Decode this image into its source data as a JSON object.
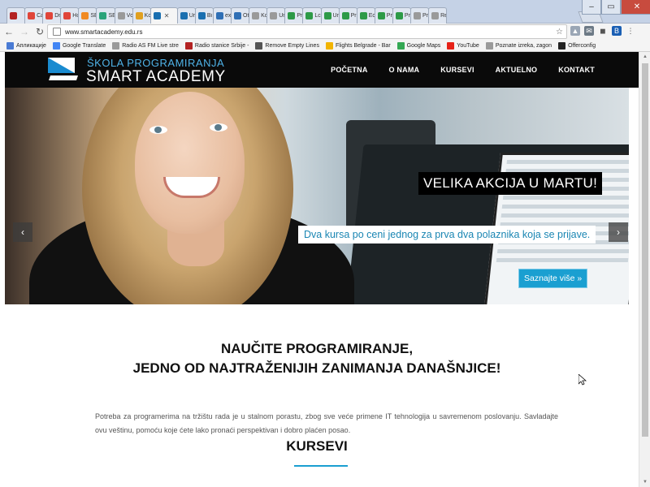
{
  "browser": {
    "tabs": [
      {
        "label": "",
        "icon": "red-tab-icon",
        "color": "#b32222"
      },
      {
        "label": "Ca",
        "icon": "heart-icon",
        "color": "#e0453a"
      },
      {
        "label": "Dr",
        "icon": "heart-icon",
        "color": "#e0453a"
      },
      {
        "label": "Hc",
        "icon": "heart-icon",
        "color": "#e0453a"
      },
      {
        "label": "ŠE",
        "icon": "orange-x-icon",
        "color": "#f08a24"
      },
      {
        "label": "ŠE",
        "icon": "green-a-icon",
        "color": "#2aa37a"
      },
      {
        "label": "Vc",
        "icon": "page-icon",
        "color": "#9a9a9a"
      },
      {
        "label": "Kc",
        "icon": "kodi-icon",
        "color": "#e0a020"
      },
      {
        "label": "",
        "icon": "smart-academy-icon",
        "color": "#1a6fb0",
        "active": true
      },
      {
        "label": "Ur",
        "icon": "smart-academy-icon",
        "color": "#1a6fb0"
      },
      {
        "label": "Bi",
        "icon": "smart-academy-icon",
        "color": "#1a6fb0"
      },
      {
        "label": "ex",
        "icon": "globe-icon",
        "color": "#2f6fb5"
      },
      {
        "label": "Ot",
        "icon": "globe-icon",
        "color": "#2f6fb5"
      },
      {
        "label": "Kc",
        "icon": "page-icon",
        "color": "#9a9a9a"
      },
      {
        "label": "Ur",
        "icon": "page-icon",
        "color": "#9a9a9a"
      },
      {
        "label": "Pr",
        "icon": "check-icon",
        "color": "#2d9a47"
      },
      {
        "label": "Lc",
        "icon": "check-icon",
        "color": "#2d9a47"
      },
      {
        "label": "Ur",
        "icon": "check-icon",
        "color": "#2d9a47"
      },
      {
        "label": "Pr",
        "icon": "check-icon",
        "color": "#2d9a47"
      },
      {
        "label": "Ec",
        "icon": "check-icon",
        "color": "#2d9a47"
      },
      {
        "label": "Pr",
        "icon": "check-icon",
        "color": "#2d9a47"
      },
      {
        "label": "Pr",
        "icon": "check-icon",
        "color": "#2d9a47"
      },
      {
        "label": "Pr",
        "icon": "page-icon",
        "color": "#9a9a9a"
      },
      {
        "label": "Re",
        "icon": "page-icon",
        "color": "#9a9a9a"
      }
    ],
    "url": "www.smartacademy.edu.rs",
    "bookmarks": [
      {
        "label": "Апликације",
        "icon": "apps-grid-icon",
        "color": "#4a7bd4"
      },
      {
        "label": "Google Translate",
        "icon": "translate-icon",
        "color": "#4285f4"
      },
      {
        "label": "Radio AS FM Live stre",
        "icon": "page-icon",
        "color": "#9a9a9a"
      },
      {
        "label": "Radio stanice Srbije -",
        "icon": "radio-icon",
        "color": "#b32222"
      },
      {
        "label": "Remove Empty Lines",
        "icon": "remove-lines-icon",
        "color": "#555555"
      },
      {
        "label": "Flights Belgrade - Bar",
        "icon": "flight-icon",
        "color": "#f2b400"
      },
      {
        "label": "Google Maps",
        "icon": "maps-icon",
        "color": "#34a853"
      },
      {
        "label": "YouTube",
        "icon": "youtube-icon",
        "color": "#e62117"
      },
      {
        "label": "Poznate izreka, zagon",
        "icon": "page-icon",
        "color": "#9a9a9a"
      },
      {
        "label": "Offerconfig",
        "icon": "offerconfig-icon",
        "color": "#222222"
      }
    ]
  },
  "site": {
    "logo_top": "ŠKOLA PROGRAMIRANJA",
    "logo_bottom": "SMART ACADEMY",
    "nav": [
      "POČETNA",
      "O NAMA",
      "KURSEVI",
      "AKTUELNO",
      "KONTAKT"
    ],
    "accent": "#1a9fd1"
  },
  "hero": {
    "title": "VELIKA AKCIJA U MARTU!",
    "subtitle": "Dva kursa po ceni jednog za prva dva polaznika koja se prijave.",
    "cta": "Saznajte više »",
    "prev": "‹",
    "next": "›"
  },
  "content": {
    "headline_1": "NAUČITE PROGRAMIRANJE,",
    "headline_2": "JEDNO OD NAJTRAŽENIJIH ZANIMANJA DANAŠNJICE!",
    "intro": "Potreba za programerima na tržištu rada je u stalnom porastu, zbog sve veće primene IT tehnologija u savremenom poslovanju. Savladajte ovu veštinu, pomoću koje ćete lako pronaći perspektivan i dobro plaćen posao.",
    "section_title": "KURSEVI"
  }
}
